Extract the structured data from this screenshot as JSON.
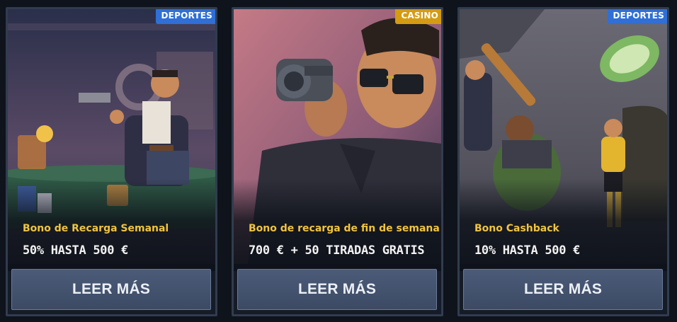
{
  "cards": [
    {
      "badge": "DEPORTES",
      "title": "Bono de Recarga Semanal",
      "offer": "50% HASTA 500 €",
      "button": "LEER MÁS",
      "illustration": "gangster-casino-table",
      "badge_color": "#2f6fd6"
    },
    {
      "badge": "CASINO",
      "title": "Bono de recarga de fin de semana",
      "offer": "700 € + 50 TIRADAS GRATIS",
      "button": "LEER MÁS",
      "illustration": "gangster-revolver",
      "badge_color": "#d59b12"
    },
    {
      "badge": "DEPORTES",
      "title": "Bono Cashback",
      "offer": "10% HASTA 500 €",
      "button": "LEER MÁS",
      "illustration": "gangsters-bat-cash",
      "badge_color": "#2f6fd6"
    }
  ],
  "colors": {
    "title": "#f0c440",
    "button_bg": "#43526d",
    "card_border": "#313c4f"
  }
}
